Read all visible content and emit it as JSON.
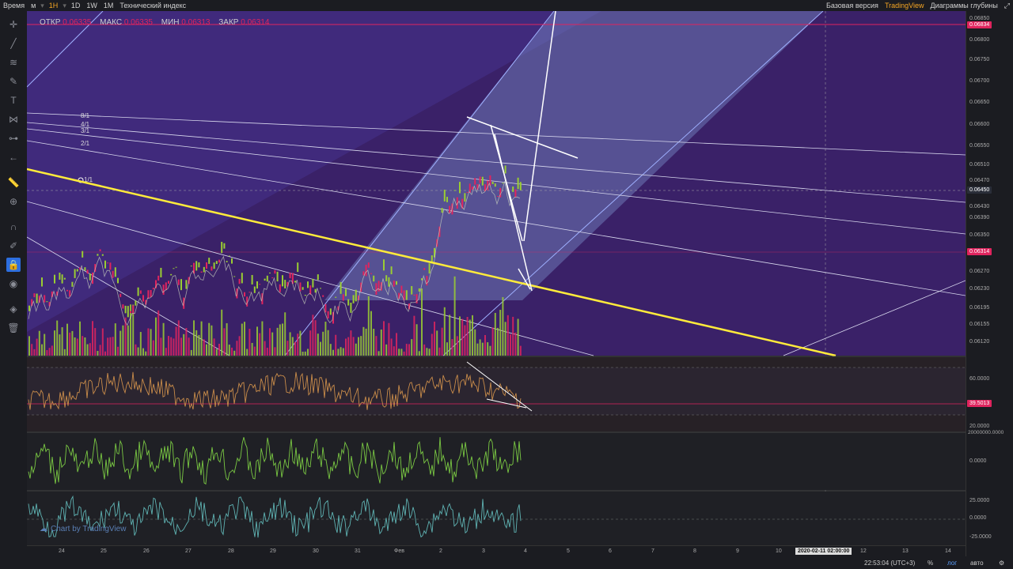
{
  "toolbar": {
    "items": [
      "Время",
      "м",
      "1H",
      "1D",
      "1W",
      "1M",
      "Технический индекс"
    ],
    "right": [
      "Базовая версия",
      "TradingView",
      "Диаграммы глубины"
    ]
  },
  "ohlc": {
    "open_label": "ОТКР",
    "open": "0.06335",
    "high_label": "МАКС",
    "high": "0.06335",
    "low_label": "МИН",
    "low": "0.06313",
    "close_label": "ЗАКР",
    "close": "0.06314"
  },
  "price_scale": {
    "labels": [
      "0.06850",
      "0.06800",
      "0.06750",
      "0.06700",
      "0.06650",
      "0.06600",
      "0.06550",
      "0.06510",
      "0.06470",
      "0.06430",
      "0.06390",
      "0.06350",
      "0.06270",
      "0.06230",
      "0.06195",
      "0.06155",
      "0.06120"
    ],
    "tags": [
      {
        "text": "0.06834",
        "color": "#e0245e"
      },
      {
        "text": "0.06450",
        "color": "#2a2e39"
      },
      {
        "text": "0.06314",
        "color": "#e0245e"
      }
    ]
  },
  "rsi_scale": {
    "labels": [
      "60.0000",
      "20.0000"
    ],
    "tag": "39.5013"
  },
  "osc_scale": {
    "labels": [
      "20000000.0000",
      "0.0000"
    ]
  },
  "osc2_scale": {
    "labels": [
      "25.0000",
      "0.0000",
      "-25.0000"
    ]
  },
  "time_scale": {
    "labels": [
      "24",
      "25",
      "26",
      "27",
      "28",
      "29",
      "30",
      "31",
      "Фев",
      "2",
      "3",
      "4",
      "5",
      "6",
      "7",
      "8",
      "9",
      "10",
      "12",
      "13",
      "14"
    ],
    "cursor": "2020-02-11 02:00:00"
  },
  "fib_labels": [
    "8/1",
    "4/1",
    "3/1",
    "2/1",
    "1/1"
  ],
  "watermark": "Chart by TradingView",
  "bottom": {
    "clock": "22:53:04 (UTC+3)",
    "percent": "%",
    "log": "лог",
    "auto": "авто"
  },
  "colors": {
    "accent": "#f5a623",
    "bull": "#9acd32",
    "bear": "#e0245e",
    "trend": "#ffeb3b",
    "panel": "#4a2a7a"
  }
}
